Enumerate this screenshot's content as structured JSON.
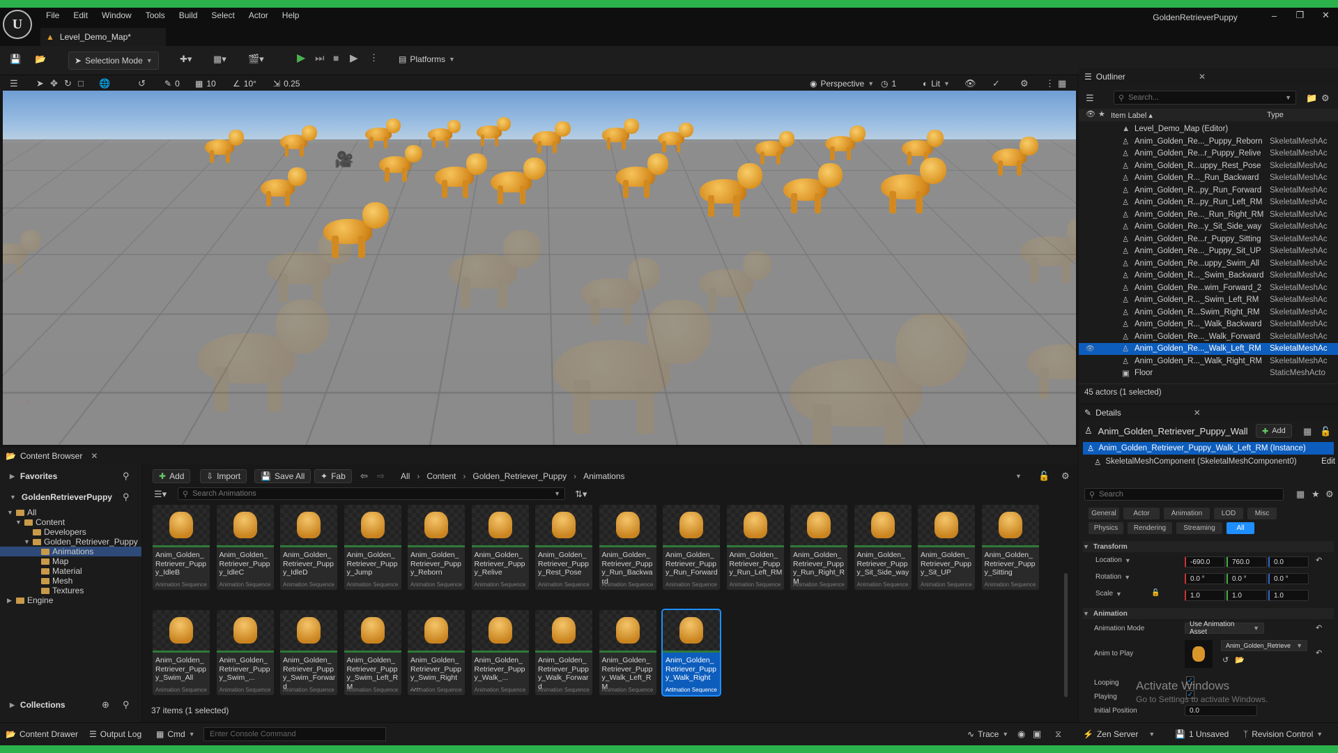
{
  "app": {
    "title": "GoldenRetrieverPuppy",
    "level_tab": "Level_Demo_Map*"
  },
  "menu": [
    "File",
    "Edit",
    "Window",
    "Tools",
    "Build",
    "Select",
    "Actor",
    "Help"
  ],
  "toolbar": {
    "selection_mode": "Selection Mode",
    "platforms": "Platforms"
  },
  "viewport": {
    "grid_move": "10",
    "grid_rot": "10°",
    "grid_scale": "0.25",
    "snap_a": "0",
    "snap_b": "0",
    "perspective": "Perspective",
    "lit": "Lit",
    "cam_speed": "1"
  },
  "outliner": {
    "title": "Outliner",
    "search_placeholder": "Search...",
    "col_label": "Item Label ▴",
    "col_type": "Type",
    "root": "Level_Demo_Map (Editor)",
    "items": [
      {
        "label": "Anim_Golden_Re..._Puppy_Reborn",
        "type": "SkeletalMeshAc"
      },
      {
        "label": "Anim_Golden_Re...r_Puppy_Relive",
        "type": "SkeletalMeshAc"
      },
      {
        "label": "Anim_Golden_R...uppy_Rest_Pose",
        "type": "SkeletalMeshAc"
      },
      {
        "label": "Anim_Golden_R..._Run_Backward",
        "type": "SkeletalMeshAc"
      },
      {
        "label": "Anim_Golden_R...py_Run_Forward",
        "type": "SkeletalMeshAc"
      },
      {
        "label": "Anim_Golden_R...py_Run_Left_RM",
        "type": "SkeletalMeshAc"
      },
      {
        "label": "Anim_Golden_Re..._Run_Right_RM",
        "type": "SkeletalMeshAc"
      },
      {
        "label": "Anim_Golden_Re...y_Sit_Side_way",
        "type": "SkeletalMeshAc"
      },
      {
        "label": "Anim_Golden_Re...r_Puppy_Sitting",
        "type": "SkeletalMeshAc"
      },
      {
        "label": "Anim_Golden_Re..._Puppy_Sit_UP",
        "type": "SkeletalMeshAc"
      },
      {
        "label": "Anim_Golden_Re...uppy_Swim_All",
        "type": "SkeletalMeshAc"
      },
      {
        "label": "Anim_Golden_R..._Swim_Backward",
        "type": "SkeletalMeshAc"
      },
      {
        "label": "Anim_Golden_Re...wim_Forward_2",
        "type": "SkeletalMeshAc"
      },
      {
        "label": "Anim_Golden_R..._Swim_Left_RM",
        "type": "SkeletalMeshAc"
      },
      {
        "label": "Anim_Golden_R...Swim_Right_RM",
        "type": "SkeletalMeshAc"
      },
      {
        "label": "Anim_Golden_R..._Walk_Backward",
        "type": "SkeletalMeshAc"
      },
      {
        "label": "Anim_Golden_Re..._Walk_Forward",
        "type": "SkeletalMeshAc"
      },
      {
        "label": "Anim_Golden_Re..._Walk_Left_RM",
        "type": "SkeletalMeshAc"
      },
      {
        "label": "Anim_Golden_R..._Walk_Right_RM",
        "type": "SkeletalMeshAc"
      },
      {
        "label": "Floor",
        "type": "StaticMeshActo"
      }
    ],
    "status": "45 actors (1 selected)"
  },
  "details": {
    "title": "Details",
    "actor_name": "Anim_Golden_Retriever_Puppy_Wall",
    "add": "Add",
    "instance": "Anim_Golden_Retriever_Puppy_Walk_Left_RM (Instance)",
    "component": "SkeletalMeshComponent (SkeletalMeshComponent0)",
    "edit": "Edit",
    "search_placeholder": "Search",
    "cats_row1": [
      "General",
      "Actor",
      "Animation",
      "LOD",
      "Misc"
    ],
    "cats_row2": [
      "Physics",
      "Rendering",
      "Streaming",
      "All"
    ],
    "transform": "Transform",
    "location": {
      "label": "Location",
      "x": "-690.0",
      "y": "760.0",
      "z": "0.0"
    },
    "rotation": {
      "label": "Rotation",
      "x": "0.0 °",
      "y": "0.0 °",
      "z": "0.0 °"
    },
    "scale": {
      "label": "Scale",
      "x": "1.0",
      "y": "1.0",
      "z": "1.0"
    },
    "animation": "Animation",
    "anim_mode_label": "Animation Mode",
    "anim_mode": "Use Animation Asset",
    "anim_to_play_label": "Anim to Play",
    "anim_to_play": "Anim_Golden_Retrieve",
    "looping": "Looping",
    "playing": "Playing",
    "initial_position_label": "Initial Position",
    "initial_position": "0.0",
    "watermark_1": "Activate Windows",
    "watermark_2": "Go to Settings to activate Windows."
  },
  "content_browser": {
    "title": "Content Browser",
    "favorites": "Favorites",
    "project": "GoldenRetrieverPuppy",
    "tree": [
      {
        "label": "All",
        "depth": 0
      },
      {
        "label": "Content",
        "depth": 1
      },
      {
        "label": "Developers",
        "depth": 2
      },
      {
        "label": "Golden_Retriever_Puppy",
        "depth": 2
      },
      {
        "label": "Animations",
        "depth": 3
      },
      {
        "label": "Map",
        "depth": 3
      },
      {
        "label": "Material",
        "depth": 3
      },
      {
        "label": "Mesh",
        "depth": 3
      },
      {
        "label": "Textures",
        "depth": 3
      },
      {
        "label": "Engine",
        "depth": 0
      }
    ],
    "collections": "Collections",
    "add": "Add",
    "import": "Import",
    "save_all": "Save All",
    "fab": "Fab",
    "breadcrumb": [
      "All",
      "Content",
      "Golden_Retriever_Puppy",
      "Animations"
    ],
    "search_placeholder": "Search Animations",
    "asset_type": "Animation Sequence",
    "assets": [
      "Anim_Golden_Retriever_Puppy_IdleB",
      "Anim_Golden_Retriever_Puppy_IdleC",
      "Anim_Golden_Retriever_Puppy_IdleD",
      "Anim_Golden_Retriever_Puppy_Jump",
      "Anim_Golden_Retriever_Puppy_Reborn",
      "Anim_Golden_Retriever_Puppy_Relive",
      "Anim_Golden_Retriever_Puppy_Rest_Pose",
      "Anim_Golden_Retriever_Puppy_Run_Backward",
      "Anim_Golden_Retriever_Puppy_Run_Forward",
      "Anim_Golden_Retriever_Puppy_Run_Left_RM",
      "Anim_Golden_Retriever_Puppy_Run_Right_RM",
      "Anim_Golden_Retriever_Puppy_Sit_Side_way",
      "Anim_Golden_Retriever_Puppy_Sit_UP",
      "Anim_Golden_Retriever_Puppy_Sitting",
      "Anim_Golden_Retriever_Puppy_Swim_All",
      "Anim_Golden_Retriever_Puppy_Swim_...",
      "Anim_Golden_Retriever_Puppy_Swim_Forward",
      "Anim_Golden_Retriever_Puppy_Swim_Left_RM",
      "Anim_Golden_Retriever_Puppy_Swim_Right_...",
      "Anim_Golden_Retriever_Puppy_Walk_...",
      "Anim_Golden_Retriever_Puppy_Walk_Forward",
      "Anim_Golden_Retriever_Puppy_Walk_Left_RM",
      "Anim_Golden_Retriever_Puppy_Walk_Right_..."
    ],
    "selected_index": 22,
    "status": "37 items (1 selected)"
  },
  "statusbar": {
    "content_drawer": "Content Drawer",
    "output_log": "Output Log",
    "cmd": "Cmd",
    "console_placeholder": "Enter Console Command",
    "trace": "Trace",
    "zen": "Zen Server",
    "unsaved": "1 Unsaved",
    "revision": "Revision Control"
  },
  "colors": {
    "accent": "#0d5dbd",
    "green_frame": "#2bb24c",
    "play": "#4caf50"
  }
}
